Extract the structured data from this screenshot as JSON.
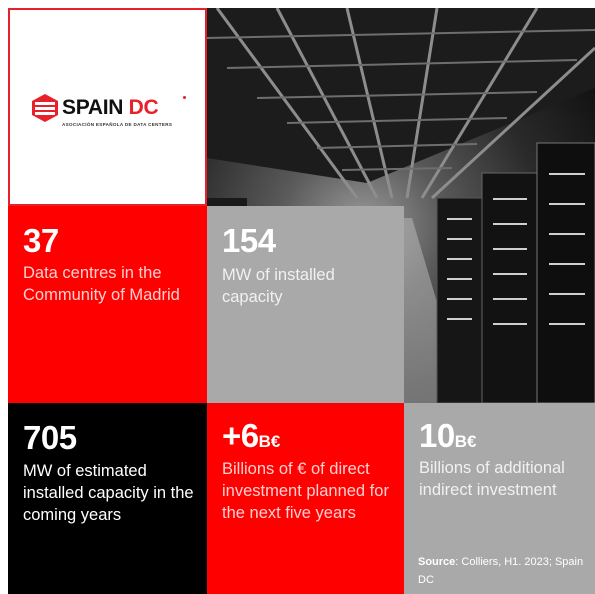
{
  "logo": {
    "name_part1": "SPAIN",
    "name_part2": "DC",
    "tagline": "ASOCIACIÓN ESPAÑOLA DE DATA CENTERS",
    "brand_color": "#e8202a"
  },
  "stats": [
    {
      "value": "37",
      "unit": "",
      "label": "Data centres in the Community of Madrid",
      "color": "#ff0000"
    },
    {
      "value": "154",
      "unit": "",
      "label": "MW of installed capacity",
      "color": "#a9a9a9"
    },
    {
      "value": "705",
      "unit": "",
      "label": "MW of estimated installed capacity in the coming years",
      "color": "#000000"
    },
    {
      "value": "+6",
      "unit": "B€",
      "label": "Billions of € of direct investment planned for the next five years",
      "color": "#ff0000"
    },
    {
      "value": "10",
      "unit": "B€",
      "label": "Billions of additional indirect investment",
      "color": "#a9a9a9"
    }
  ],
  "source": {
    "label": "Source",
    "text": ": Colliers, H1. 2023; Spain DC"
  },
  "photo_subject": "server-room-photo"
}
